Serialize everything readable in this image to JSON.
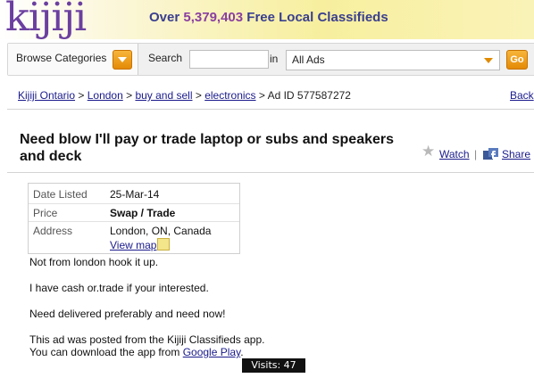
{
  "brand": {
    "logo": "kijiji",
    "tagline_prefix": "Over",
    "ad_count": "5,379,403",
    "tagline_suffix": "Free Local Classifieds",
    "accent": "#6b3fa0",
    "button_color": "#f0a020"
  },
  "search": {
    "browse_label": "Browse Categories",
    "search_label": "Search",
    "query_value": "",
    "in_label": "in",
    "category_selected": "All Ads",
    "go_label": "Go"
  },
  "breadcrumb": {
    "items": [
      "Kijiji Ontario",
      "London",
      "buy and sell",
      "electronics"
    ],
    "ad_id": "Ad ID 577587272",
    "back_label": "Back"
  },
  "ad": {
    "title": "Need blow I'll pay or trade laptop or subs and speakers and deck",
    "watch_label": "Watch",
    "share_label": "Share",
    "details": {
      "date_label": "Date Listed",
      "date_value": "25-Mar-14",
      "price_label": "Price",
      "price_value": "Swap / Trade",
      "address_label": "Address",
      "address_value": "London, ON, Canada",
      "map_link": "View map"
    },
    "description": [
      "Not from london hook it up.",
      "I have cash or.trade if your interested.",
      "Need delivered preferably and need now!",
      "This ad was posted from the Kijiji Classifieds app."
    ],
    "app_line_prefix": "You can download the app from",
    "app_link": "Google Play",
    "app_line_suffix": ".",
    "visits": "Visits: 47"
  }
}
